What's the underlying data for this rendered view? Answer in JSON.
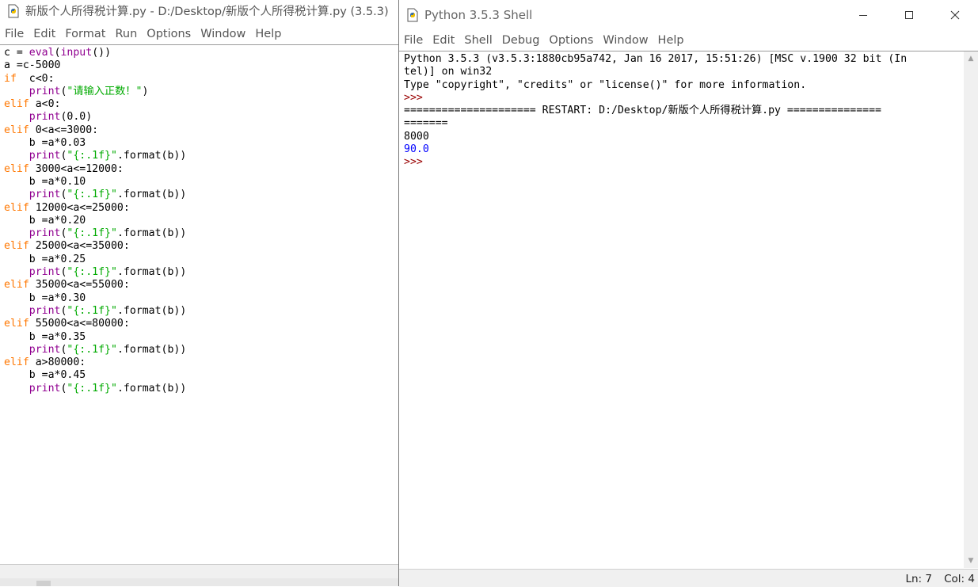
{
  "editor": {
    "title": "新版个人所得税计算.py - D:/Desktop/新版个人所得税计算.py (3.5.3)",
    "menu": [
      "File",
      "Edit",
      "Format",
      "Run",
      "Options",
      "Window",
      "Help"
    ],
    "code_lines": [
      [
        [
          "c = ",
          ""
        ],
        [
          "eval",
          "bi"
        ],
        [
          "(",
          ""
        ],
        [
          "input",
          "bi"
        ],
        [
          "())",
          ""
        ]
      ],
      [
        [
          "a =c-5000",
          ""
        ]
      ],
      [
        [
          "if",
          "kw"
        ],
        [
          "  c<0:",
          ""
        ]
      ],
      [
        [
          "    ",
          ""
        ],
        [
          "print",
          "bi"
        ],
        [
          "(",
          ""
        ],
        [
          "\"请输入正数！\"",
          "str"
        ],
        [
          ")",
          ""
        ]
      ],
      [
        [
          "elif",
          "kw"
        ],
        [
          " a<0:",
          ""
        ]
      ],
      [
        [
          "    ",
          ""
        ],
        [
          "print",
          "bi"
        ],
        [
          "(0.0)",
          ""
        ]
      ],
      [
        [
          "elif",
          "kw"
        ],
        [
          " 0<a<=3000:",
          ""
        ]
      ],
      [
        [
          "    b =a*0.03",
          ""
        ]
      ],
      [
        [
          "    ",
          ""
        ],
        [
          "print",
          "bi"
        ],
        [
          "(",
          ""
        ],
        [
          "\"{:.1f}\"",
          "str"
        ],
        [
          ".format(b))",
          ""
        ]
      ],
      [
        [
          "elif",
          "kw"
        ],
        [
          " 3000<a<=12000:",
          ""
        ]
      ],
      [
        [
          "    b =a*0.10",
          ""
        ]
      ],
      [
        [
          "    ",
          ""
        ],
        [
          "print",
          "bi"
        ],
        [
          "(",
          ""
        ],
        [
          "\"{:.1f}\"",
          "str"
        ],
        [
          ".format(b))",
          ""
        ]
      ],
      [
        [
          "elif",
          "kw"
        ],
        [
          " 12000<a<=25000:",
          ""
        ]
      ],
      [
        [
          "    b =a*0.20",
          ""
        ]
      ],
      [
        [
          "    ",
          ""
        ],
        [
          "print",
          "bi"
        ],
        [
          "(",
          ""
        ],
        [
          "\"{:.1f}\"",
          "str"
        ],
        [
          ".format(b))",
          ""
        ]
      ],
      [
        [
          "elif",
          "kw"
        ],
        [
          " 25000<a<=35000:",
          ""
        ]
      ],
      [
        [
          "    b =a*0.25",
          ""
        ]
      ],
      [
        [
          "    ",
          ""
        ],
        [
          "print",
          "bi"
        ],
        [
          "(",
          ""
        ],
        [
          "\"{:.1f}\"",
          "str"
        ],
        [
          ".format(b))",
          ""
        ]
      ],
      [
        [
          "elif",
          "kw"
        ],
        [
          " 35000<a<=55000:",
          ""
        ]
      ],
      [
        [
          "    b =a*0.30",
          ""
        ]
      ],
      [
        [
          "    ",
          ""
        ],
        [
          "print",
          "bi"
        ],
        [
          "(",
          ""
        ],
        [
          "\"{:.1f}\"",
          "str"
        ],
        [
          ".format(b))",
          ""
        ]
      ],
      [
        [
          "elif",
          "kw"
        ],
        [
          " 55000<a<=80000:",
          ""
        ]
      ],
      [
        [
          "    b =a*0.35",
          ""
        ]
      ],
      [
        [
          "    ",
          ""
        ],
        [
          "print",
          "bi"
        ],
        [
          "(",
          ""
        ],
        [
          "\"{:.1f}\"",
          "str"
        ],
        [
          ".format(b))",
          ""
        ]
      ],
      [
        [
          "elif",
          "kw"
        ],
        [
          " a>80000:",
          ""
        ]
      ],
      [
        [
          "    b =a*0.45",
          ""
        ]
      ],
      [
        [
          "    ",
          ""
        ],
        [
          "print",
          "bi"
        ],
        [
          "(",
          ""
        ],
        [
          "\"{:.1f}\"",
          "str"
        ],
        [
          ".format(b))",
          ""
        ]
      ]
    ]
  },
  "shell": {
    "title": "Python 3.5.3 Shell",
    "menu": [
      "File",
      "Edit",
      "Shell",
      "Debug",
      "Options",
      "Window",
      "Help"
    ],
    "lines": [
      [
        [
          "Python 3.5.3 (v3.5.3:1880cb95a742, Jan 16 2017, 15:51:26) [MSC v.1900 32 bit (In",
          ""
        ]
      ],
      [
        [
          "tel)] on win32",
          ""
        ]
      ],
      [
        [
          "Type \"copyright\", \"credits\" or \"license()\" for more information.",
          ""
        ]
      ],
      [
        [
          ">>> ",
          "prompt"
        ]
      ],
      [
        [
          "===================== RESTART: D:/Desktop/新版个人所得税计算.py ===============",
          ""
        ]
      ],
      [
        [
          "=======",
          ""
        ]
      ],
      [
        [
          "8000",
          ""
        ]
      ],
      [
        [
          "90.0",
          "out"
        ]
      ],
      [
        [
          ">>> ",
          "prompt"
        ]
      ]
    ],
    "status": {
      "ln": "Ln: 7",
      "col": "Col: 4"
    }
  },
  "icons": [
    "python-file-icon",
    "minimize-icon",
    "maximize-icon",
    "close-icon",
    "scroll-up-arrow-icon",
    "scroll-down-arrow-icon"
  ]
}
